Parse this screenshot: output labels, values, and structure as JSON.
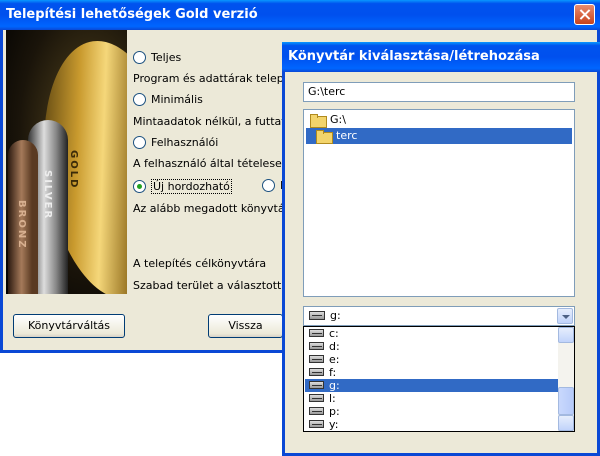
{
  "main": {
    "title": "Telepítési lehetőségek  Gold verzió",
    "options": [
      {
        "label": "Teljes",
        "desc": "Program és adattárak telepítése",
        "checked": false
      },
      {
        "label": "Minimális",
        "desc": "Mintaadatok nélkül, a futtatásho",
        "checked": false
      },
      {
        "label": "Felhasználói",
        "desc": "A felhasználó által tételesen meg",
        "checked": false
      },
      {
        "label": "Új hordozható",
        "desc": "Az alább megadott könyvtárba",
        "checked": true
      }
    ],
    "extra_option": "N",
    "target_dir_label": "A telepítés célkönyvtára",
    "free_space_label": "Szabad terület a választott meg",
    "buttons": {
      "change_dir": "Könyvtárváltás",
      "back": "Vissza"
    },
    "image_text": {
      "gold": "GOLD",
      "silver": "SILVER",
      "bronze": "BRONZ"
    }
  },
  "dialog": {
    "title": "Könyvtár kiválasztása/létrehozása",
    "path_value": "G:\\terc",
    "tree": [
      {
        "label": "G:\\",
        "selected": false
      },
      {
        "label": "terc",
        "selected": true
      }
    ],
    "drive_selected": "g:",
    "drives": [
      {
        "label": "c:",
        "selected": false
      },
      {
        "label": "d:",
        "selected": false
      },
      {
        "label": "e:",
        "selected": false
      },
      {
        "label": "f:",
        "selected": false
      },
      {
        "label": "g:",
        "selected": true
      },
      {
        "label": "l:",
        "selected": false
      },
      {
        "label": "p:",
        "selected": false
      },
      {
        "label": "y:",
        "selected": false
      }
    ]
  }
}
